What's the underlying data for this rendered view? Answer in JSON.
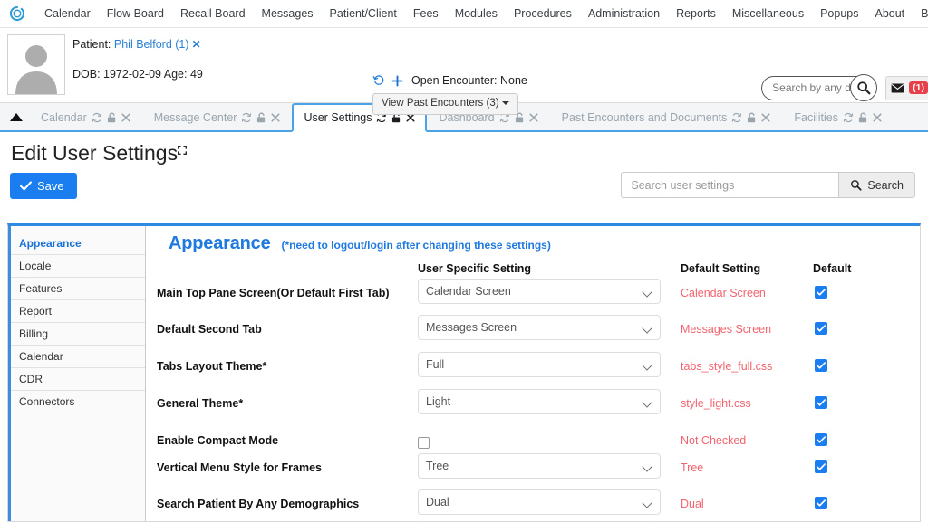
{
  "topnav": {
    "logo_icon": "openemr-ring-logo",
    "items": [
      {
        "label": "Calendar"
      },
      {
        "label": "Flow Board"
      },
      {
        "label": "Recall Board"
      },
      {
        "label": "Messages"
      },
      {
        "label": "Patient/Client"
      },
      {
        "label": "Fees"
      },
      {
        "label": "Modules"
      },
      {
        "label": "Procedures"
      },
      {
        "label": "Administration"
      },
      {
        "label": "Reports"
      },
      {
        "label": "Miscellaneous"
      },
      {
        "label": "Popups"
      },
      {
        "label": "About"
      },
      {
        "label": "Billy Smith"
      }
    ]
  },
  "patient_bar": {
    "avatar_icon": "person-avatar",
    "patient_label": "Patient:",
    "patient_name": "Phil Belford (1)",
    "patient_close_icon": "close-x-icon",
    "dob_line": "DOB: 1972-02-09 Age: 49",
    "history_icon": "history-clock-icon",
    "add_icon": "plus-icon",
    "open_encounter": "Open Encounter: None",
    "view_past_encounters": "View Past Encounters  (3)",
    "search": {
      "placeholder": "Search by any demographics",
      "value": "",
      "icon": "search-icon"
    },
    "mail": {
      "icon": "envelope-icon",
      "badge": "(1)"
    }
  },
  "tabstrip": {
    "collapse_icon": "triangle-up-icon",
    "tabs": [
      {
        "label": "Calendar",
        "active": false
      },
      {
        "label": "Message Center",
        "active": false
      },
      {
        "label": "User Settings",
        "active": true
      },
      {
        "label": "Dashboard",
        "active": false
      },
      {
        "label": "Past Encounters and Documents",
        "active": false
      },
      {
        "label": "Facilities",
        "active": false
      }
    ],
    "tab_icons": {
      "refresh": "refresh-icon",
      "lock": "unlocked-padlock-icon",
      "close": "close-x-icon"
    }
  },
  "page_header": {
    "title": "Edit User Settings",
    "move_icon": "move-arrows-icon",
    "save_label": "Save",
    "save_icon": "check-icon",
    "search_placeholder": "Search user settings",
    "search_value": "",
    "search_button_label": "Search",
    "search_button_icon": "search-icon"
  },
  "sidebar": {
    "items": [
      {
        "label": "Appearance",
        "active": true
      },
      {
        "label": "Locale",
        "active": false
      },
      {
        "label": "Features",
        "active": false
      },
      {
        "label": "Report",
        "active": false
      },
      {
        "label": "Billing",
        "active": false
      },
      {
        "label": "Calendar",
        "active": false
      },
      {
        "label": "CDR",
        "active": false
      },
      {
        "label": "Connectors",
        "active": false
      }
    ]
  },
  "content": {
    "section_title": "Appearance",
    "section_note": "(*need to logout/login after changing these settings)",
    "columns": {
      "user_specific": "User Specific Setting",
      "default_setting": "Default Setting",
      "default": "Default"
    },
    "rows": [
      {
        "label": "Main Top Pane Screen(Or Default First Tab)",
        "control": "select",
        "value": "Calendar Screen",
        "default_setting": "Calendar Screen",
        "default_checked": true
      },
      {
        "label": "Default Second Tab",
        "control": "select",
        "value": "Messages Screen",
        "default_setting": "Messages Screen",
        "default_checked": true
      },
      {
        "label": "Tabs Layout Theme*",
        "control": "select",
        "value": "Full",
        "default_setting": "tabs_style_full.css",
        "default_checked": true
      },
      {
        "label": "General Theme*",
        "control": "select",
        "value": "Light",
        "default_setting": "style_light.css",
        "default_checked": true
      },
      {
        "label": "Enable Compact Mode",
        "control": "checkbox",
        "value": "",
        "checked": false,
        "default_setting": "Not Checked",
        "default_checked": true
      },
      {
        "label": "Vertical Menu Style for Frames",
        "control": "select",
        "value": "Tree",
        "default_setting": "Tree",
        "default_checked": true
      },
      {
        "label": "Search Patient By Any Demographics",
        "control": "select",
        "value": "Dual",
        "default_setting": "Dual",
        "default_checked": true
      }
    ]
  },
  "colors": {
    "accent_blue": "#1a7ef0",
    "tab_border_blue": "#4aa3e8",
    "section_blue": "#1f7ae0",
    "default_red": "#f4636f",
    "badge_red": "#e8404a"
  }
}
